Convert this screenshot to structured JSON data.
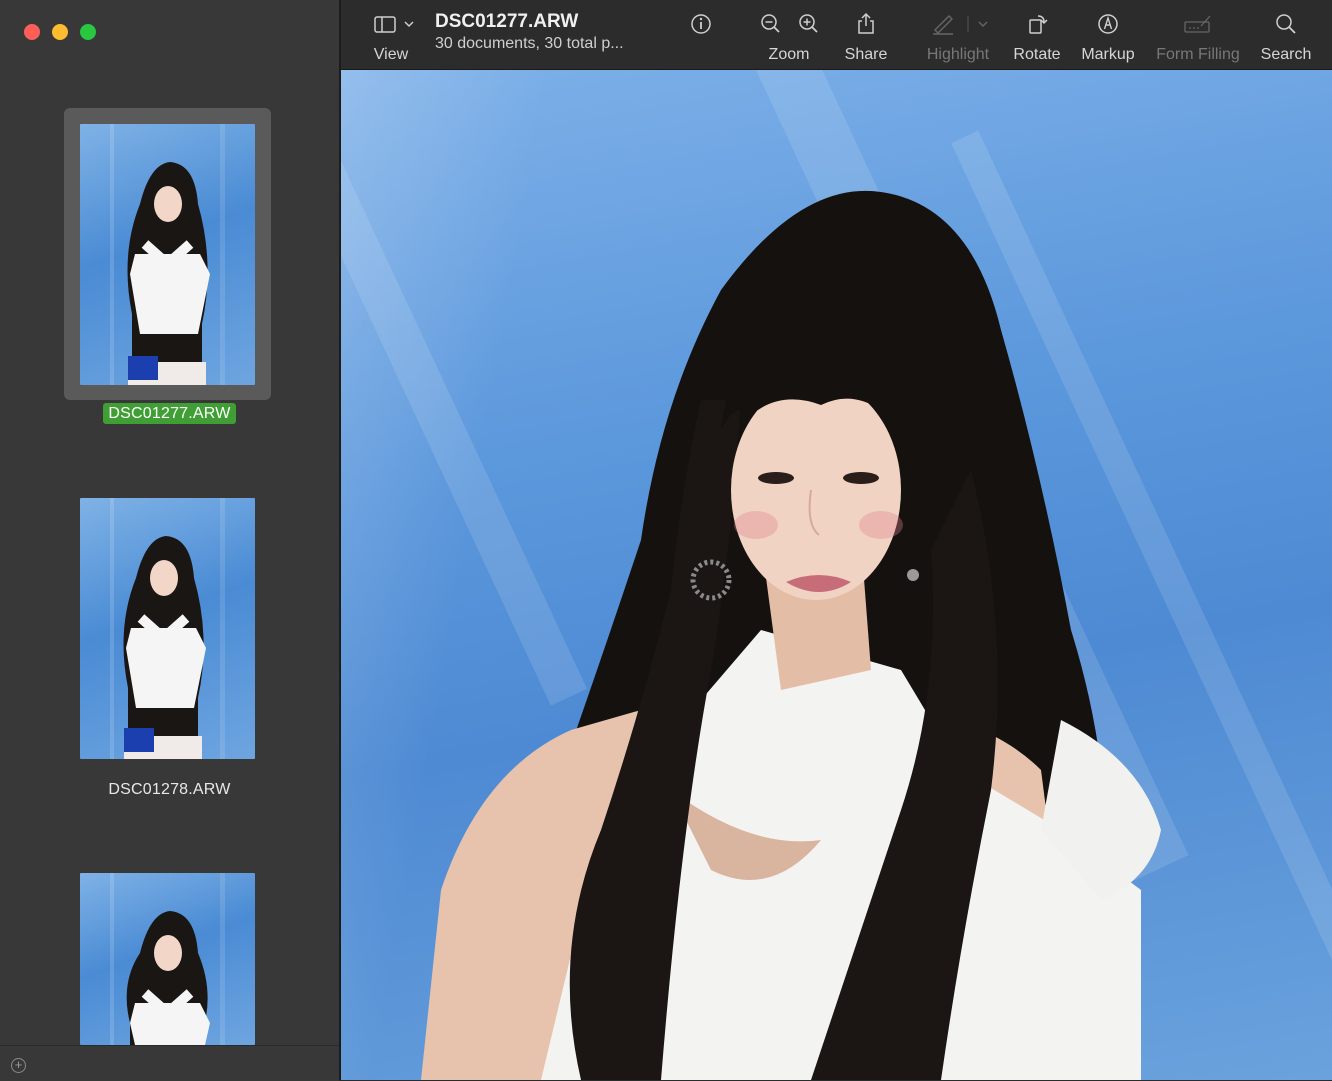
{
  "window": {
    "title": "DSC01277.ARW",
    "subtitle": "30 documents, 30 total p..."
  },
  "toolbar": {
    "view_label": "View",
    "zoom_label": "Zoom",
    "share_label": "Share",
    "highlight_label": "Highlight",
    "rotate_label": "Rotate",
    "markup_label": "Markup",
    "form_filling_label": "Form Filling",
    "search_label": "Search"
  },
  "sidebar": {
    "items": [
      {
        "label": "DSC01277.ARW",
        "selected": true
      },
      {
        "label": "DSC01278.ARW",
        "selected": false
      },
      {
        "label": "",
        "selected": false
      }
    ]
  },
  "colors": {
    "selection_badge": "#3f9f34",
    "backdrop_blue": "#5c98dc",
    "close": "#fe5f57",
    "minimize": "#febc2e",
    "zoom": "#28c840"
  },
  "icons": {
    "view": "sidebar-icon",
    "info": "info-icon",
    "zoom_out": "zoom-out-icon",
    "zoom_in": "zoom-in-icon",
    "share": "share-icon",
    "highlight": "pen-icon",
    "rotate": "rotate-icon",
    "markup": "markup-icon",
    "form_filling": "form-icon",
    "search": "search-icon",
    "add": "plus-circle-icon"
  }
}
